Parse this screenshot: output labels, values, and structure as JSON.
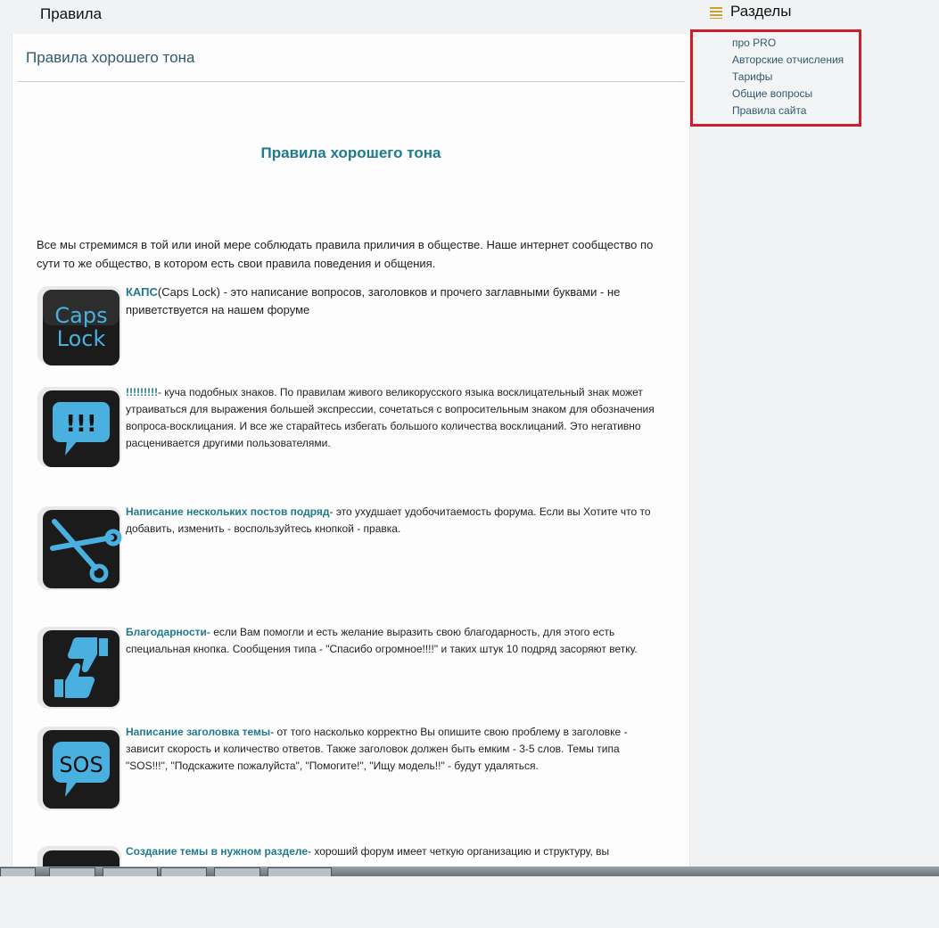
{
  "page": {
    "heading": "Правила"
  },
  "main": {
    "panel_title": "Правила хорошего тона",
    "article_title": "Правила хорошего тона",
    "intro": "Все мы стремимся в той или иной мере соблюдать правила приличия в обществе. Наше интернет сообщество по сути то же общество, в котором есть свои правила поведения и общения.",
    "rules": [
      {
        "icon": "caps-lock-icon",
        "icon_text": "Caps Lock",
        "title": "КАПС",
        "text": "(Caps Lock) - это написание вопросов, заголовков и прочего заглавными буквами - не приветствуется на нашем форуме"
      },
      {
        "icon": "exclamation-bubble-icon",
        "icon_text": "!!!",
        "title": "!!!!!!!!!",
        "text": "- куча подобных знаков. По правилам живого великорусского языка восклицательный знак может утраиваться для выражения большей экспрессии, сочетаться с вопросительным знаком для обозначения вопроса-восклицания. И все же старайтесь избегать большого количества восклицаний. Это негативно расценивается другими пользователями."
      },
      {
        "icon": "scissors-icon",
        "title": "Написание нескольких постов подряд",
        "text": "- это ухудшает удобочитаемость форума. Если вы Хотите что то добавить, изменить - воспользуйтесь кнопкой - правка."
      },
      {
        "icon": "thumbs-up-down-icon",
        "title": "Благодарности",
        "text": "- если Вам помогли и есть желание выразить свою благодарность, для этого есть специальная кнопка. Сообщения типа - \"Спасибо огромное!!!!\" и таких штук 10 подряд засоряют ветку."
      },
      {
        "icon": "sos-bubble-icon",
        "icon_text": "SOS",
        "title": "Написание заголовка темы",
        "text": "- от того насколько корректно Вы опишите свою проблему в заголовке - зависит скорость и количество ответов. Также заголовок должен быть емким - 3-5 слов. Темы типа \"SOS!!!\", \"Подскажите пожалуйста\", \"Помогите!\", \"Ищу модель!!\" - будут удаляться."
      },
      {
        "icon": "forum-icon",
        "title": "Создание темы в нужном разделе",
        "text": "- хороший форум имеет четкую организацию и структуру, вы"
      }
    ]
  },
  "sidebar": {
    "header": "Разделы",
    "icon": "list-icon",
    "items": [
      {
        "label": "про PRO"
      },
      {
        "label": "Авторские отчисления"
      },
      {
        "label": "Тарифы"
      },
      {
        "label": "Общие вопросы"
      },
      {
        "label": "Правила сайта"
      }
    ]
  },
  "colors": {
    "accent": "#1f7a8e",
    "link": "#2f5a6d",
    "highlight_border": "#cc1f2a",
    "icon_blue": "#3aa3d6"
  }
}
